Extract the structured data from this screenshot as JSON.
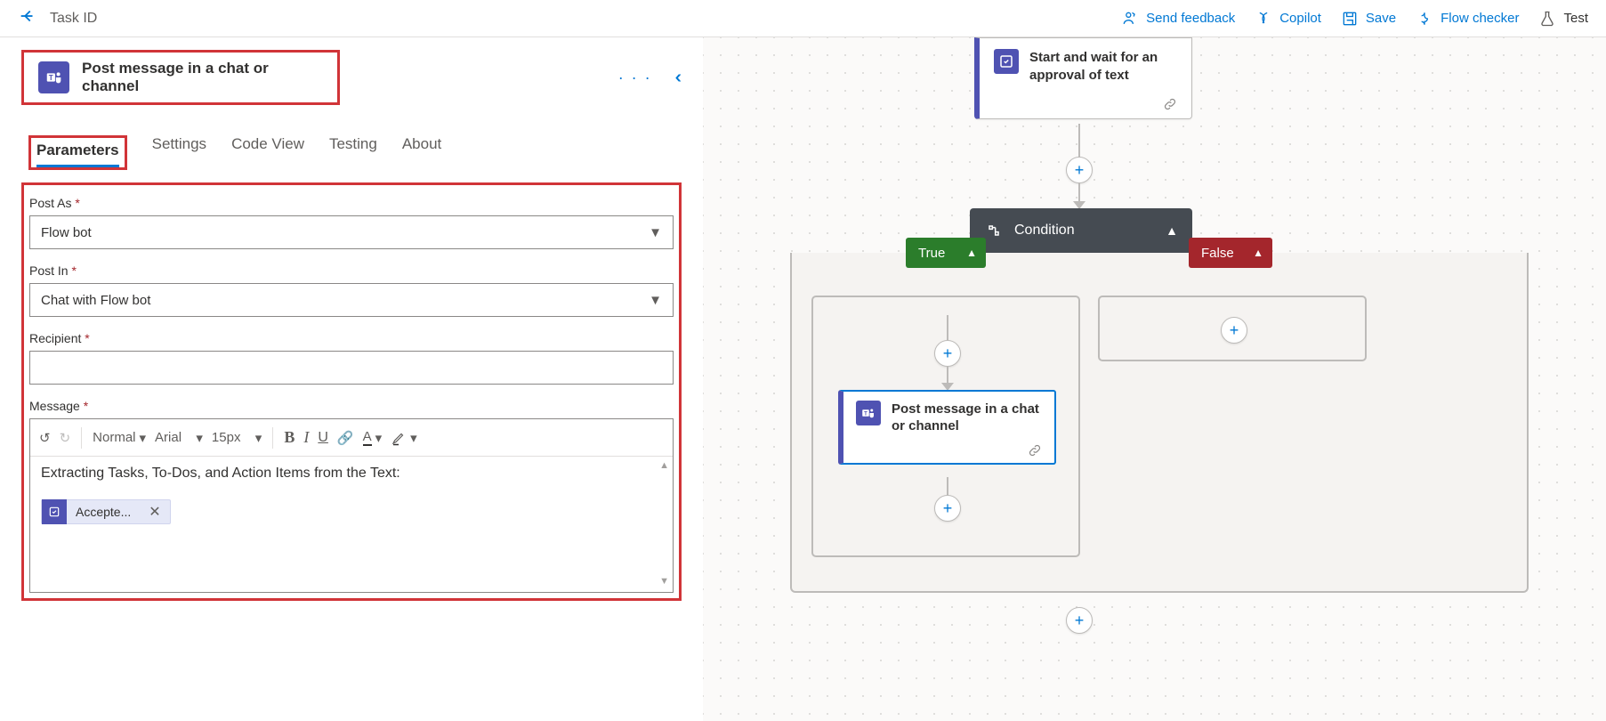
{
  "header": {
    "breadcrumb": "Task ID",
    "commands": {
      "feedback": "Send feedback",
      "copilot": "Copilot",
      "save": "Save",
      "flow_checker": "Flow checker",
      "test": "Test"
    }
  },
  "action_panel": {
    "title": "Post message in a chat or channel",
    "tabs": [
      "Parameters",
      "Settings",
      "Code View",
      "Testing",
      "About"
    ],
    "active_tab_index": 0,
    "fields": {
      "post_as": {
        "label": "Post As",
        "value": "Flow bot"
      },
      "post_in": {
        "label": "Post In",
        "value": "Chat with Flow bot"
      },
      "recipient": {
        "label": "Recipient",
        "value": ""
      },
      "message": {
        "label": "Message",
        "toolbar": {
          "style": "Normal",
          "font": "Arial",
          "size": "15px"
        },
        "text": "Extracting Tasks, To-Dos, and Action Items from the Text:",
        "token": "Accepte..."
      }
    }
  },
  "flow": {
    "approval_title": "Start and wait for an approval of text",
    "condition_label": "Condition",
    "true_label": "True",
    "false_label": "False",
    "teams_action_title": "Post message in a chat or channel"
  }
}
